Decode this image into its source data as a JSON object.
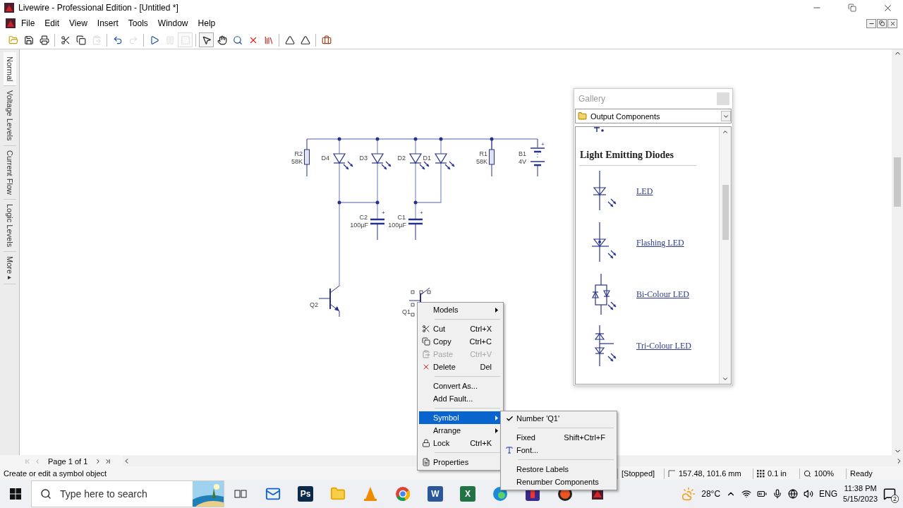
{
  "window": {
    "title": "Livewire - Professional Edition - [Untitled *]"
  },
  "menu": [
    "File",
    "Edit",
    "View",
    "Insert",
    "Tools",
    "Window",
    "Help"
  ],
  "toolbar": [
    {
      "kind": "open",
      "disabled": false,
      "selected": false
    },
    {
      "kind": "save",
      "disabled": false,
      "selected": false
    },
    {
      "kind": "print",
      "disabled": false,
      "selected": false
    },
    {
      "kind": "separator"
    },
    {
      "kind": "cut",
      "disabled": false,
      "selected": false
    },
    {
      "kind": "copy",
      "disabled": false,
      "selected": false
    },
    {
      "kind": "paste",
      "disabled": true,
      "selected": false
    },
    {
      "kind": "separator"
    },
    {
      "kind": "undo",
      "disabled": false,
      "selected": false
    },
    {
      "kind": "redo",
      "disabled": true,
      "selected": false
    },
    {
      "kind": "separator"
    },
    {
      "kind": "run",
      "disabled": false,
      "selected": false
    },
    {
      "kind": "pause",
      "disabled": true,
      "selected": false
    },
    {
      "kind": "stop",
      "disabled": true,
      "selected": true
    },
    {
      "kind": "separator"
    },
    {
      "kind": "select",
      "disabled": false,
      "selected": true
    },
    {
      "kind": "pan",
      "disabled": false,
      "selected": false
    },
    {
      "kind": "zoom",
      "disabled": false,
      "selected": false
    },
    {
      "kind": "delete",
      "disabled": false,
      "selected": false
    },
    {
      "kind": "library",
      "disabled": false,
      "selected": false
    },
    {
      "kind": "separator"
    },
    {
      "kind": "mirror",
      "disabled": false,
      "selected": false
    },
    {
      "kind": "flip",
      "disabled": false,
      "selected": false
    },
    {
      "kind": "separator"
    },
    {
      "kind": "toolbox",
      "disabled": false,
      "selected": false
    }
  ],
  "view_tabs": [
    {
      "label": "Normal",
      "selected": true
    },
    {
      "label": "Voltage Levels",
      "selected": false
    },
    {
      "label": "Current Flow",
      "selected": false
    },
    {
      "label": "Logic Levels",
      "selected": false
    },
    {
      "label": "More",
      "selected": false
    }
  ],
  "schematic": {
    "components": [
      {
        "kind": "resistor",
        "ref": "R2",
        "value": "58K",
        "selected": false
      },
      {
        "kind": "led",
        "ref": "D4",
        "selected": false
      },
      {
        "kind": "led",
        "ref": "D3",
        "selected": false
      },
      {
        "kind": "led",
        "ref": "D2",
        "selected": false
      },
      {
        "kind": "led",
        "ref": "D1",
        "selected": false
      },
      {
        "kind": "resistor",
        "ref": "R1",
        "value": "58K",
        "selected": false
      },
      {
        "kind": "battery",
        "ref": "B1",
        "value": "4V",
        "polarity": "+",
        "selected": false
      },
      {
        "kind": "capacitor",
        "ref": "C2",
        "value": "100µF",
        "polarity": "+",
        "selected": false
      },
      {
        "kind": "capacitor",
        "ref": "C1",
        "value": "100µF",
        "polarity": "+",
        "selected": false
      },
      {
        "kind": "transistor",
        "ref": "Q2",
        "selected": false
      },
      {
        "kind": "transistor",
        "ref": "Q1",
        "selected": true
      }
    ]
  },
  "gallery": {
    "title": "Gallery",
    "category": "Output Components",
    "heading": "Light Emitting Diodes",
    "items": [
      {
        "kind": "led",
        "label": "LED"
      },
      {
        "kind": "flashing",
        "label": "Flashing LED"
      },
      {
        "kind": "bicolour",
        "label": "Bi-Colour LED"
      },
      {
        "kind": "tricolour",
        "label": "Tri-Colour LED"
      }
    ]
  },
  "context_menu": {
    "items": [
      {
        "kind": "submenu",
        "label": "Models",
        "selected": false,
        "disabled": false
      },
      {
        "kind": "separator"
      },
      {
        "kind": "command",
        "label": "Cut",
        "shortcut": "Ctrl+X",
        "selected": false,
        "disabled": false
      },
      {
        "kind": "command",
        "label": "Copy",
        "shortcut": "Ctrl+C",
        "selected": false,
        "disabled": false
      },
      {
        "kind": "command",
        "label": "Paste",
        "shortcut": "Ctrl+V",
        "selected": false,
        "disabled": true
      },
      {
        "kind": "command",
        "label": "Delete",
        "shortcut": "Del",
        "selected": false,
        "disabled": false
      },
      {
        "kind": "separator"
      },
      {
        "kind": "command",
        "label": "Convert As...",
        "selected": false,
        "disabled": false
      },
      {
        "kind": "command",
        "label": "Add Fault...",
        "selected": false,
        "disabled": false
      },
      {
        "kind": "separator"
      },
      {
        "kind": "submenu",
        "label": "Symbol",
        "selected": true,
        "disabled": false
      },
      {
        "kind": "submenu",
        "label": "Arrange",
        "selected": false,
        "disabled": false
      },
      {
        "kind": "command",
        "label": "Lock",
        "shortcut": "Ctrl+K",
        "selected": false,
        "disabled": false
      },
      {
        "kind": "separator"
      },
      {
        "kind": "command",
        "label": "Properties",
        "selected": false,
        "disabled": false
      }
    ]
  },
  "submenu": {
    "items": [
      {
        "kind": "command",
        "label": "Number 'Q1'",
        "checked": true
      },
      {
        "kind": "separator"
      },
      {
        "kind": "command",
        "label": "Fixed",
        "shortcut": "Shift+Ctrl+F",
        "checked": false
      },
      {
        "kind": "command",
        "label": "Font...",
        "checked": false
      },
      {
        "kind": "separator"
      },
      {
        "kind": "command",
        "label": "Restore Labels",
        "checked": false
      },
      {
        "kind": "command",
        "label": "Renumber Components",
        "checked": false
      }
    ]
  },
  "page_bar": {
    "page": "Page 1 of 1"
  },
  "status_bar": {
    "hint": "Create or edit a symbol object",
    "sim_state": "[Stopped]",
    "coordinates": "157.48, 101.6 mm",
    "grid": "0.1 in",
    "zoom": "100%",
    "status": "Ready"
  },
  "taskbar": {
    "search": {
      "placeholder": "Type here to search"
    },
    "apps": [
      {
        "kind": "taskview"
      },
      {
        "kind": "mail"
      },
      {
        "kind": "photoshop",
        "label": "Ps"
      },
      {
        "kind": "explorer"
      },
      {
        "kind": "vlc"
      },
      {
        "kind": "chrome"
      },
      {
        "kind": "word",
        "label": "W"
      },
      {
        "kind": "excel",
        "label": "X"
      },
      {
        "kind": "edge"
      },
      {
        "kind": "app"
      },
      {
        "kind": "record"
      },
      {
        "kind": "livewire"
      }
    ],
    "weather": "28°C",
    "language": "ENG",
    "time": "11:38 PM",
    "date": "5/15/2023",
    "notifications": "2"
  }
}
